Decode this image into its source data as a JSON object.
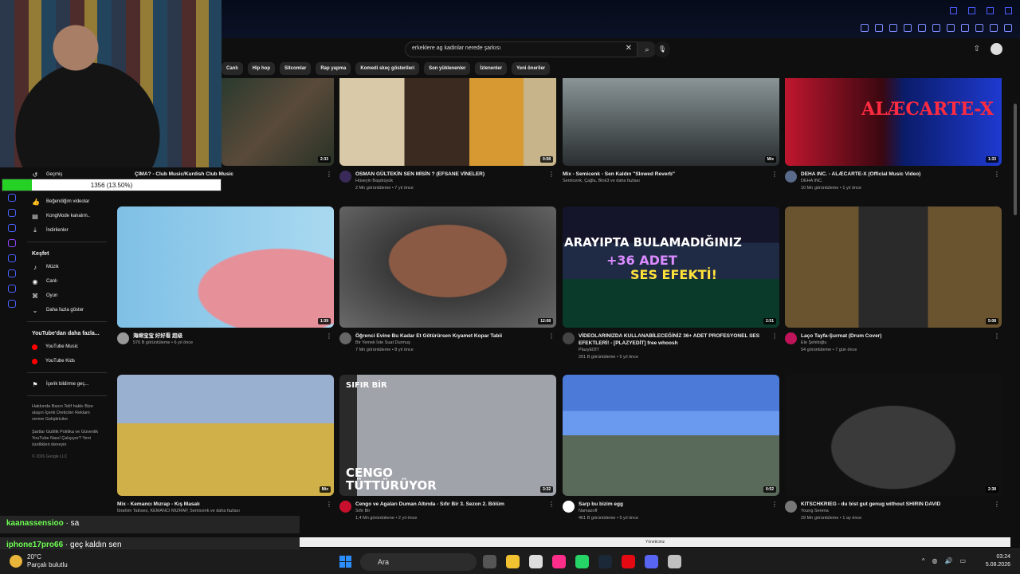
{
  "header": {
    "search_value": "erkeklere ag kadinlar nerede şarkısı",
    "chips": [
      "Canlı",
      "Hip hop",
      "Sitcomlar",
      "Rap yapma",
      "Komedi skeç gösterileri",
      "Son yüklenenler",
      "İzlenenler",
      "Yeni öneriler"
    ]
  },
  "progress": {
    "text": "1356 (13.50%)",
    "fraction": 0.135
  },
  "sidebar": {
    "top_items": [
      {
        "label": "Geçmiş",
        "icon": "history-icon"
      },
      {
        "label": "Beğendiğim videolar",
        "icon": "like-icon"
      },
      {
        "label": "KongMode kanalım..",
        "icon": "playlist-icon"
      },
      {
        "label": "İndirilenler",
        "icon": "download-icon"
      }
    ],
    "explore_title": "Keşfet",
    "explore_items": [
      {
        "label": "Müzik",
        "icon": "music-icon"
      },
      {
        "label": "Canlı",
        "icon": "live-icon"
      },
      {
        "label": "Oyun",
        "icon": "gamepad-icon"
      },
      {
        "label": "Daha fazla göster",
        "icon": "chevron-down-icon"
      }
    ],
    "more_title": "YouTube'dan daha fazla...",
    "more_items": [
      {
        "label": "YouTube Music",
        "icon": "youtube-music-icon"
      },
      {
        "label": "YouTube Kids",
        "icon": "youtube-kids-icon"
      }
    ],
    "report_label": "İçerik bildirme geç...",
    "footer1": "Hakkında  Basın  Telif hakkı  Bize ulaşın  İçerik Üreticiler  Reklam verme  Geliştiriciler",
    "footer2": "Şartlar  Gizlilik  Politika ve Güvenlik  YouTube Nasıl Çalışıyor?  Yeni özellikleri deneyin",
    "copyright": "© 2026 Google LLC"
  },
  "videos": [
    {
      "title": "ÇIMA? - Club Music/Kurdish Club Music",
      "channel": "",
      "stats": "",
      "duration": "2:33",
      "color": "#3c4a3a"
    },
    {
      "title": "OSMAN GÜLTEKİN SEN MİSİN ? (EFSANE VİNELER)",
      "channel": "Hüseyin Başıbüyük",
      "stats": "2 Mn görüntüleme • 7 yıl önce",
      "duration": "0:58",
      "color": "#b9873f"
    },
    {
      "title": "Mix - Semicenk - Sen Kaldın \"Slowed Reverb\"",
      "channel": "Semicenk, Çağla, Blok3 ve daha fazlası",
      "stats": "",
      "duration": "Mix",
      "color": "#5d6567"
    },
    {
      "title": "DEHA INC. - ALÆCARTE-X (Official Music Video)",
      "channel": "DEHA INC.",
      "stats": "10 Mn görüntüleme • 1 yıl önce",
      "duration": "1:33",
      "color": "#7a1022"
    },
    {
      "title": "海绵宝宝 好好看 超级",
      "channel": "",
      "stats": "576 B görüntüleme • 6 yıl önce",
      "duration": "1:39",
      "color": "#74b7e0"
    },
    {
      "title": "Öğrenci Evine Bu Kadar Et Götürürsen Kıyamet Kopar Tabii",
      "channel": "Bir Yemek İste Suat Durmuş",
      "stats": "7 Mn görüntüleme • 8 yıl önce",
      "duration": "12:08",
      "color": "#6d5242"
    },
    {
      "title": "VİDEOLARINIZDA KULLANABİLECEĞİNİZ 36+ ADET PROFESYONEL SES EFEKTLERİ! - [PLAZYEDİT] free whoosh",
      "channel": "PlazyEDİT",
      "stats": "201 B görüntüleme • 5 yıl önce",
      "duration": "2:51",
      "color": "#1b1b3a"
    },
    {
      "title": "Laço Tayfa-Şurmat (Drum Cover)",
      "channel": "Ele Şehitoğlu",
      "stats": "54 görüntüleme • 7 gün önce",
      "duration": "5:08",
      "color": "#6a5430"
    },
    {
      "title": "Mix - Kemancı Mızrap - Kış Masalı",
      "channel": "İbrahim Tatlıses, KEMANCI MIZRAP, Semicenk ve daha fazlası",
      "stats": "",
      "duration": "Mix",
      "color": "#b58a3a"
    },
    {
      "title": "Cengo ve Agaları Duman Altında - Sıfır Bir 3. Sezon 2. Bölüm",
      "channel": "Sıfır Bir",
      "stats": "1,4 Mn görüntüleme • 2 yıl önce",
      "duration": "3:32",
      "color": "#8a8d93"
    },
    {
      "title": "Sarp bu bizim egg",
      "channel": "Namazoff",
      "stats": "461 B görüntüleme • 5 yıl önce",
      "duration": "0:52",
      "color": "#4b7ad8"
    },
    {
      "title": "KITSCHKRIEG - du bist gut genug without SHIRIN DAVID",
      "channel": "Young Serena",
      "stats": "29 Mn görüntüleme • 1 ay önce",
      "duration": "2:38",
      "color": "#2a2a2a"
    }
  ],
  "thumb_overlays": {
    "deha": "ALÆCARTE-X",
    "plazy1": "ARAYIPTA BULAMADIĞINIZ",
    "plazy2": "+36 ADET",
    "plazy3": "SES EFEKTİ!",
    "sifir": "SIFIR BİR",
    "cengo1": "CENGO",
    "cengo2": "TÜTTÜRÜYOR"
  },
  "chat": [
    {
      "user": "kaanassensioo",
      "msg": "· sa"
    },
    {
      "user": "iphone17pro66",
      "msg": "· geç kaldın sen"
    }
  ],
  "bottom_strip": "Yöneticiniz",
  "taskbar": {
    "temp": "20°C",
    "weather": "Parçalı bulutlu",
    "search": "Ara",
    "time": "03:24",
    "date": "5.08.2026"
  }
}
